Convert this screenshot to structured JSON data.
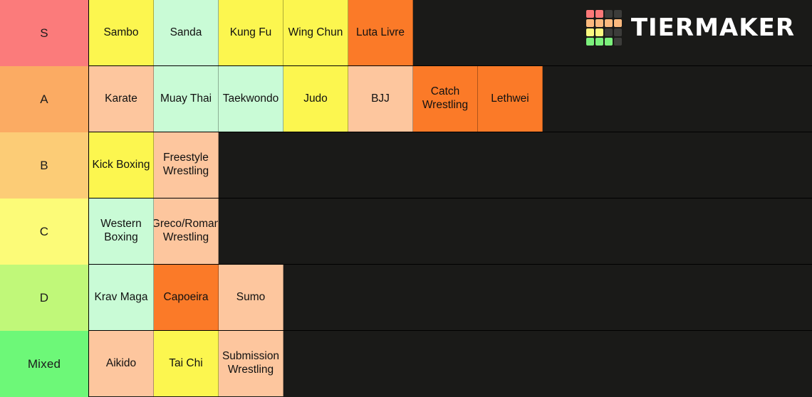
{
  "app": {
    "name": "TierMaker",
    "wordmark": "TIERMAKER",
    "background_color": "#1a1a18",
    "logo_colors": {
      "red": "#fc7878",
      "orange": "#fcb97e",
      "yellow": "#fbf880",
      "green": "#7cf07c",
      "empty": "#3c3c3a"
    },
    "logo_grid": [
      [
        "red",
        "red",
        "empty",
        "empty"
      ],
      [
        "orange",
        "orange",
        "orange",
        "orange"
      ],
      [
        "yellow",
        "yellow",
        "empty",
        "empty"
      ],
      [
        "green",
        "green",
        "green",
        "empty"
      ]
    ]
  },
  "palette": {
    "yellow": "#fcf64f",
    "mint": "#c9fbd6",
    "orange": "#fb7a28",
    "peach": "#fdc69e",
    "tier_s": "#fb7b7b",
    "tier_a": "#fbab63",
    "tier_b": "#fccc76",
    "tier_c": "#fcfb78",
    "tier_d": "#c0f879",
    "tier_mixed": "#6df878"
  },
  "tiers": [
    {
      "label": "S",
      "label_color": "#fb7b7b",
      "items": [
        {
          "label": "Sambo",
          "color": "#fcf64f"
        },
        {
          "label": "Sanda",
          "color": "#c9fbd6"
        },
        {
          "label": "Kung Fu",
          "color": "#fcf64f"
        },
        {
          "label": "Wing Chun",
          "color": "#fcf64f"
        },
        {
          "label": "Luta Livre",
          "color": "#fb7a28"
        }
      ]
    },
    {
      "label": "A",
      "label_color": "#fbab63",
      "items": [
        {
          "label": "Karate",
          "color": "#fdc69e"
        },
        {
          "label": "Muay Thai",
          "color": "#c9fbd6"
        },
        {
          "label": "Taekwondo",
          "color": "#c9fbd6"
        },
        {
          "label": "Judo",
          "color": "#fcf64f"
        },
        {
          "label": "BJJ",
          "color": "#fdc69e"
        },
        {
          "label": "Catch Wrestling",
          "color": "#fb7a28"
        },
        {
          "label": "Lethwei",
          "color": "#fb7a28"
        }
      ]
    },
    {
      "label": "B",
      "label_color": "#fccc76",
      "items": [
        {
          "label": "Kick Boxing",
          "color": "#fcf64f"
        },
        {
          "label": "Freestyle Wrestling",
          "color": "#fdc69e"
        }
      ]
    },
    {
      "label": "C",
      "label_color": "#fcfb78",
      "items": [
        {
          "label": "Western Boxing",
          "color": "#c9fbd6"
        },
        {
          "label": "Greco/Roman Wrestling",
          "color": "#fdc69e"
        }
      ]
    },
    {
      "label": "D",
      "label_color": "#c0f879",
      "items": [
        {
          "label": "Krav Maga",
          "color": "#c9fbd6"
        },
        {
          "label": "Capoeira",
          "color": "#fb7a28"
        },
        {
          "label": "Sumo",
          "color": "#fdc69e"
        }
      ]
    },
    {
      "label": "Mixed",
      "label_color": "#6df878",
      "items": [
        {
          "label": "Aikido",
          "color": "#fdc69e"
        },
        {
          "label": "Tai Chi",
          "color": "#fcf64f"
        },
        {
          "label": "Submission Wrestling",
          "color": "#fdc69e"
        }
      ]
    }
  ]
}
